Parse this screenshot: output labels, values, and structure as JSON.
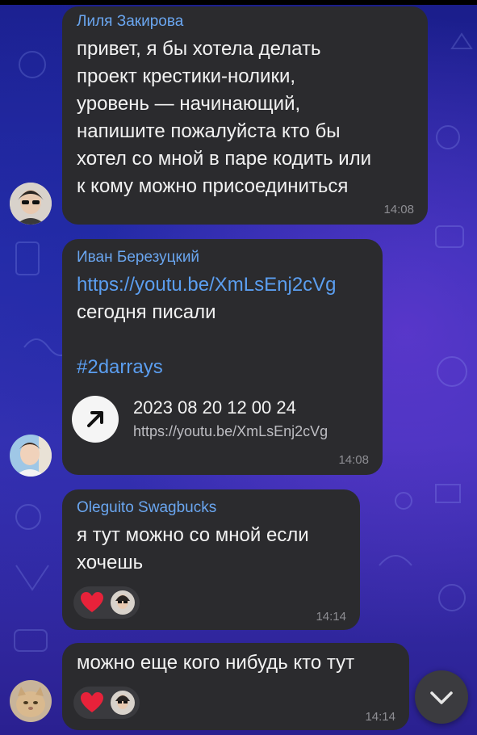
{
  "messages": [
    {
      "sender": "Лиля Закирова",
      "lines": [
        "привет, я бы хотела делать",
        "проект крестики-нолики,",
        "уровень — начинающий,",
        "напишите пожалуйста кто бы",
        "хотел со мной в паре кодить или",
        "к кому можно присоединиться"
      ],
      "time": "14:08"
    },
    {
      "sender": "Иван Березуцкий",
      "link": "https://youtu.be/XmLsEnj2cVg",
      "text": "сегодня писали",
      "hashtag": "#2darrays",
      "preview_title": "2023 08 20 12 00 24",
      "preview_url": "https://youtu.be/XmLsEnj2cVg",
      "time": "14:08"
    },
    {
      "sender": "Oleguito Swagbucks",
      "lines": [
        "я тут можно со мной если",
        "хочешь"
      ],
      "time": "14:14"
    },
    {
      "text": "можно еще кого нибудь кто тут",
      "time": "14:14"
    }
  ],
  "icons": {
    "reaction": "heart-icon",
    "link_preview": "arrow-up-right-icon",
    "scroll_down": "chevron-down-icon"
  },
  "colors": {
    "bubble": "#2b2b2e",
    "sender_name": "#6aa6f0",
    "link": "#5b9ef0",
    "heart": "#e8223a"
  }
}
